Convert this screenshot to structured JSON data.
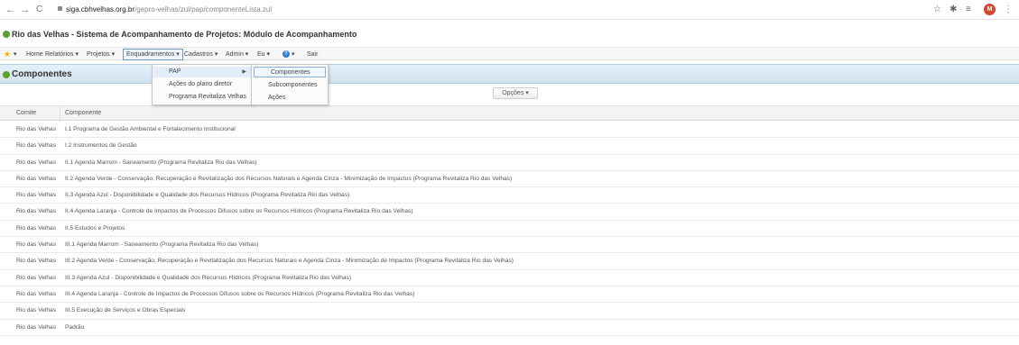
{
  "browser": {
    "back": "←",
    "forward": "→",
    "reload": "C",
    "url_host": "siga.cbhvelhas.org.br",
    "url_path": "/gepro-velhas/zul/pap/componenteLista.zul",
    "avatar_letter": "M"
  },
  "app": {
    "title": "Rio das Velhas - Sistema de Acompanhamento de Projetos: Módulo de Acompanhamento"
  },
  "menu": {
    "home": "Home",
    "relatorios": "Relatórios ▾",
    "projetos": "Projetos ▾",
    "enquadramentos": "Enquadramentos ▾",
    "cadastros": "Cadastros ▾",
    "admin": "Admin ▾",
    "eu": "Eu ▾",
    "help_arrow": "▾",
    "sair": "Sair"
  },
  "dropdown1": {
    "items": [
      "PAP",
      "Ações do plano diretor",
      "Programa Revitaliza Velhas"
    ]
  },
  "dropdown2": {
    "items": [
      "Componentes",
      "Subcomponentes",
      "Ações"
    ]
  },
  "panel": {
    "title": "Componentes",
    "options_button": "Opções ▾"
  },
  "grid": {
    "columns": [
      "Comite",
      "Componente"
    ],
    "rows": [
      {
        "comite": "Rio das Velhas",
        "componente": "I.1 Programa de Gestão Ambiental e Fortalecimento Institucional"
      },
      {
        "comite": "Rio das Velhas",
        "componente": "I.2 Instrumentos de Gestão"
      },
      {
        "comite": "Rio das Velhas",
        "componente": "II.1 Agenda Marrom - Saneamento (Programa Revitaliza Rio das Velhas)"
      },
      {
        "comite": "Rio das Velhas",
        "componente": "II.2 Agenda Verde - Conservação, Recuperação e Revitalização dos Recursos Naturais e Agenda Cinza - Minimização de Impactos (Programa Revitaliza Rio das Velhas)"
      },
      {
        "comite": "Rio das Velhas",
        "componente": "II.3 Agenda Azul - Disponibilidade e Qualidade dos Recursos Hídricos (Programa Revitaliza Rio das Velhas)"
      },
      {
        "comite": "Rio das Velhas",
        "componente": "II.4 Agenda Laranja - Controle de Impactos de Processos Difusos sobre os Recursos Hídricos (Programa Revitaliza Rio das Velhas)"
      },
      {
        "comite": "Rio das Velhas",
        "componente": "II.5 Estudos e Projetos"
      },
      {
        "comite": "Rio das Velhas",
        "componente": "III.1 Agenda Marrom - Saneamento (Programa Revitaliza Rio das Velhas)"
      },
      {
        "comite": "Rio das Velhas",
        "componente": "III.2 Agenda Verde - Conservação, Recuperação e Revitalização dos Recursos Naturais e Agenda Cinza - Minimização de Impactos (Programa Revitaliza Rio das Velhas)"
      },
      {
        "comite": "Rio das Velhas",
        "componente": "III.3 Agenda Azul - Disponibilidade e Qualidade dos Recursos Hídricos (Programa Revitaliza Rio das Velhas)"
      },
      {
        "comite": "Rio das Velhas",
        "componente": "III.4 Agenda Laranja - Controle de Impactos de Processos Difusos sobre os Recursos Hídricos (Programa Revitaliza Rio das Velhas)"
      },
      {
        "comite": "Rio das Velhas",
        "componente": "III.5 Execução de Serviços e Obras Especiais"
      },
      {
        "comite": "Rio das Velhas",
        "componente": "Padrão"
      }
    ]
  },
  "colors": {
    "accent": "#5aa02c",
    "panel_header": "#d7e7f2",
    "avatar": "#d9462f"
  }
}
